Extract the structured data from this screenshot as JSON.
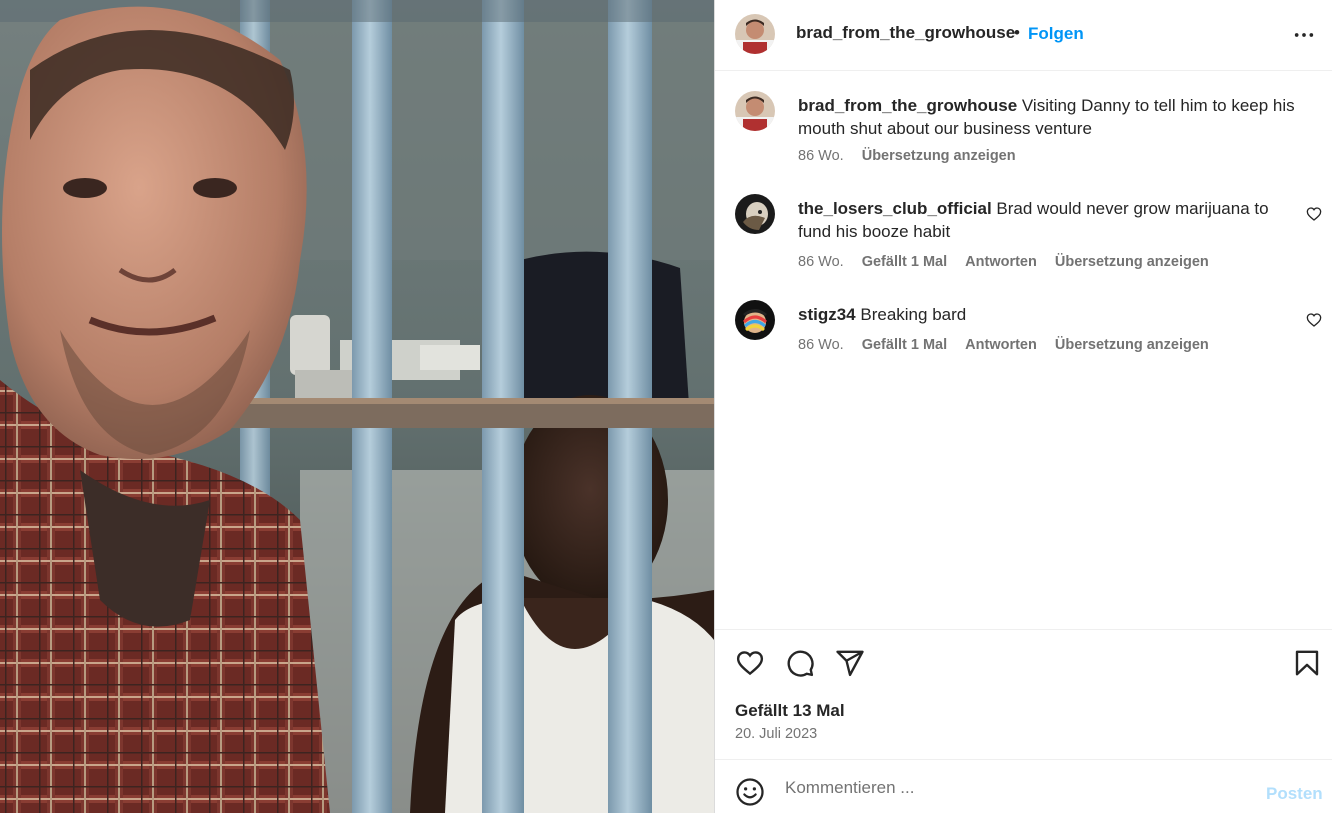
{
  "post": {
    "username": "brad_from_the_growhouse",
    "follow_label": "Folgen",
    "dot": "•",
    "more_icon": "more-horizontal-icon",
    "image_alt": "Two men at a prison cell"
  },
  "comments": [
    {
      "username": "brad_from_the_growhouse",
      "text": "Visiting Danny to tell him to keep his mouth shut about our business venture",
      "age": "86 Wo.",
      "likes": "",
      "reply": "",
      "translate": "Übersetzung anzeigen",
      "is_caption": true
    },
    {
      "username": "the_losers_club_official",
      "text": "Brad would never grow marijuana to fund his booze habit",
      "age": "86 Wo.",
      "likes": "Gefällt 1 Mal",
      "reply": "Antworten",
      "translate": "Übersetzung anzeigen",
      "is_caption": false
    },
    {
      "username": "stigz34",
      "text": "Breaking bard",
      "age": "86 Wo.",
      "likes": "Gefällt 1 Mal",
      "reply": "Antworten",
      "translate": "Übersetzung anzeigen",
      "is_caption": false
    }
  ],
  "actions": {
    "like_icon": "heart-icon",
    "comment_icon": "comment-icon",
    "share_icon": "share-icon",
    "save_icon": "bookmark-icon",
    "likes_count": "Gefällt 13 Mal",
    "date": "20. Juli 2023"
  },
  "composer": {
    "placeholder": "Kommentieren ...",
    "post_label": "Posten",
    "emoji_icon": "emoji-icon"
  },
  "colors": {
    "accent": "#0095f6",
    "post_disabled": "#b2dffc",
    "meta_text": "#737373",
    "border": "#dbdbdb"
  }
}
